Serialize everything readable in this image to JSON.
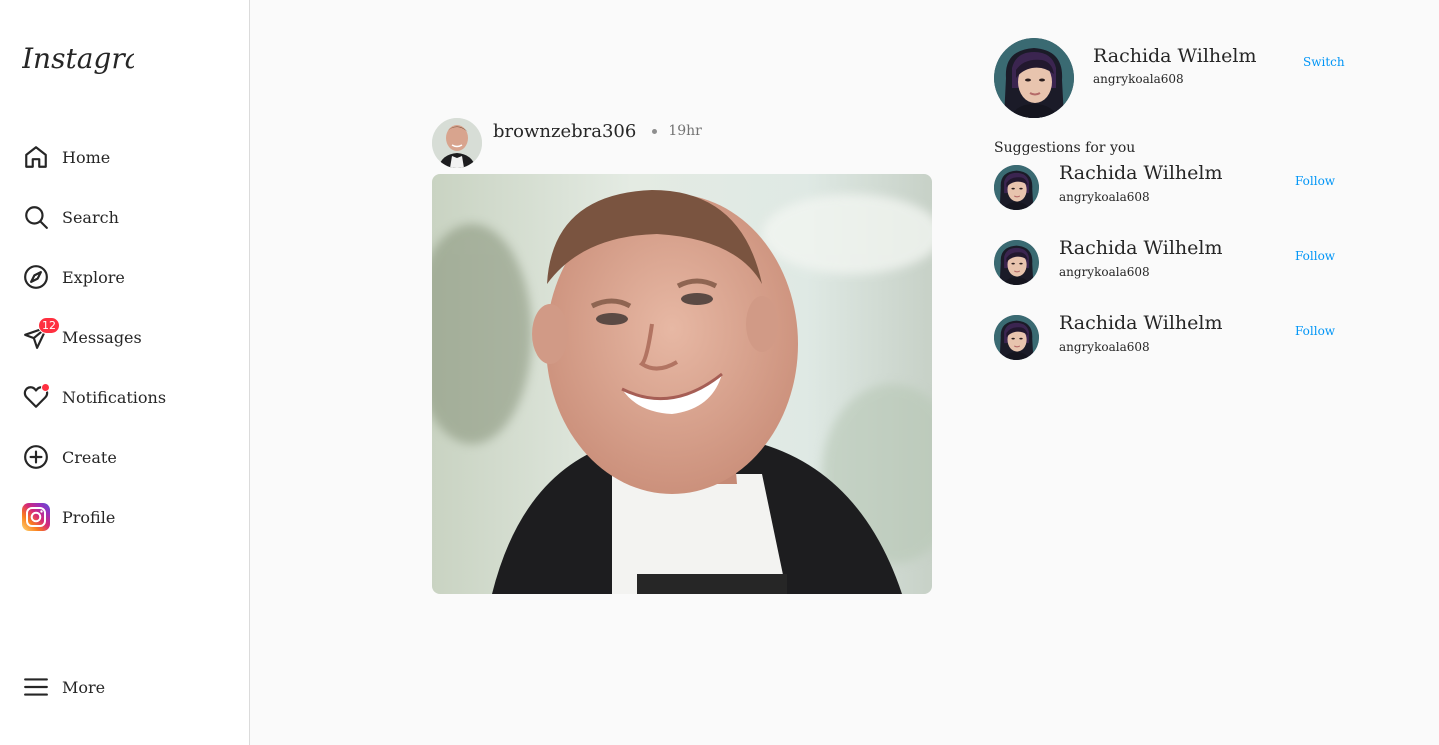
{
  "app": {
    "logo_text": "Instagram"
  },
  "sidebar": {
    "items": [
      {
        "label": "Home",
        "icon": "home-icon"
      },
      {
        "label": "Search",
        "icon": "search-icon"
      },
      {
        "label": "Explore",
        "icon": "compass-icon"
      },
      {
        "label": "Messages",
        "icon": "paper-plane-icon",
        "badge": "12"
      },
      {
        "label": "Notifications",
        "icon": "heart-icon",
        "dot": true
      },
      {
        "label": "Create",
        "icon": "plus-circle-icon"
      },
      {
        "label": "Profile",
        "icon": "instagram-profile-icon"
      }
    ],
    "more_label": "More"
  },
  "post": {
    "username": "brownzebra306",
    "time": "19hr"
  },
  "current_user": {
    "name": "Rachida Wilhelm",
    "handle": "angrykoala608",
    "switch_label": "Switch"
  },
  "suggestions": {
    "title": "Suggestions for you",
    "items": [
      {
        "name": "Rachida Wilhelm",
        "handle": "angrykoala608",
        "action": "Follow"
      },
      {
        "name": "Rachida Wilhelm",
        "handle": "angrykoala608",
        "action": "Follow"
      },
      {
        "name": "Rachida Wilhelm",
        "handle": "angrykoala608",
        "action": "Follow"
      }
    ]
  },
  "colors": {
    "accent_link": "#0095f6",
    "badge": "#ff3040",
    "background": "#fafafa"
  }
}
